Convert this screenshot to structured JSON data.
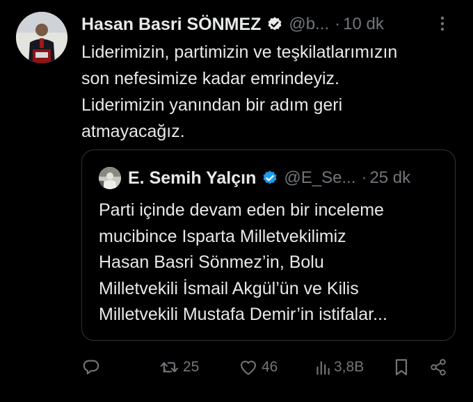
{
  "tweet": {
    "author_name": "Hasan Basri SÖNMEZ",
    "handle": "@b...",
    "separator": "·",
    "time": "10 dk",
    "lines": [
      "Liderimizin, partimizin ve teşkilatlarımızın",
      "son nefesimize kadar emrindeyiz.",
      "Liderimizin yanından bir adım geri",
      "atmayacağız."
    ]
  },
  "quoted": {
    "author_name": "E. Semih Yalçın",
    "handle": "@E_Se...",
    "separator": "·",
    "time": "25 dk",
    "lines": [
      "Parti içinde devam eden bir inceleme",
      "mucibince  Isparta  Milletvekilimiz",
      "Hasan Basri Sönmez’in, Bolu",
      "Milletvekili İsmail Akgül’ün ve Kilis",
      "Milletvekili Mustafa Demir’in istifalar..."
    ]
  },
  "actions": {
    "retweets": "25",
    "likes": "46",
    "views": "3,8B"
  },
  "icons": [
    "verified-badge-icon",
    "more-icon",
    "reply-icon",
    "retweet-icon",
    "like-icon",
    "views-icon",
    "bookmark-icon",
    "share-icon"
  ],
  "colors": {
    "background": "#000000",
    "text": "#e7e9ea",
    "muted": "#71767b",
    "verified": "#1d9bf0",
    "border": "#2f3336"
  }
}
